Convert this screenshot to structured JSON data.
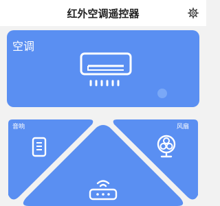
{
  "header": {
    "title": "红外空调遥控器"
  },
  "cards": {
    "ac": {
      "label": "空调"
    },
    "audio": {
      "label": "音响"
    },
    "fan": {
      "label": "风扇"
    }
  },
  "icons": {
    "settings": "gear-icon",
    "ac": "air-conditioner-icon",
    "audio": "speaker-icon",
    "fan": "fan-icon",
    "router": "router-icon"
  },
  "colors": {
    "card_blue": "#5a8ff2",
    "background": "#f2f2f2",
    "text_on_card": "#ffffff"
  }
}
